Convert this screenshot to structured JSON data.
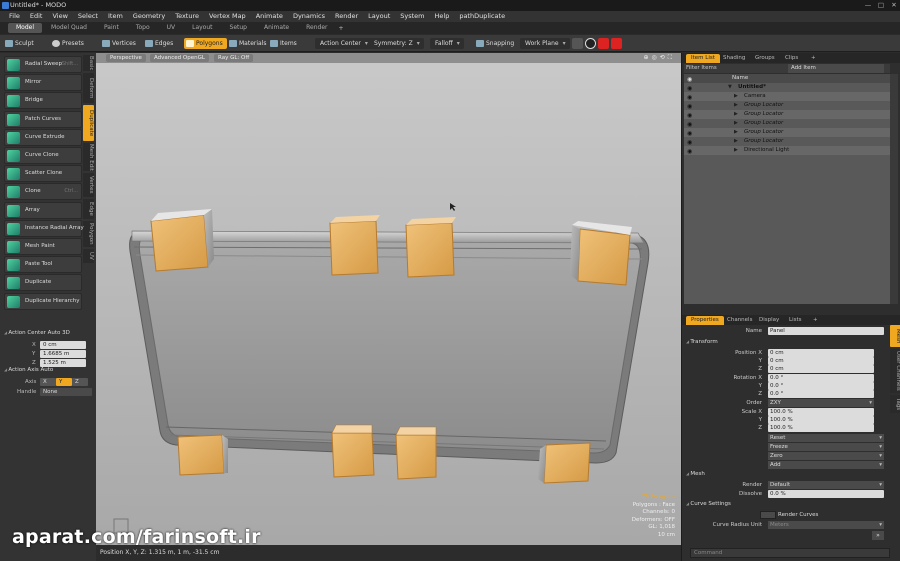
{
  "window": {
    "title": "Untitled* - MODO",
    "controls": [
      "—",
      "□",
      "✕"
    ]
  },
  "menu": [
    "File",
    "Edit",
    "View",
    "Select",
    "Item",
    "Geometry",
    "Texture",
    "Vertex Map",
    "Animate",
    "Dynamics",
    "Render",
    "Layout",
    "System",
    "Help",
    "pathDuplicate"
  ],
  "layout_tabs": [
    "Model",
    "Model Quad",
    "Paint",
    "Topo",
    "UV",
    "Layout",
    "Setup",
    "Animate",
    "Render"
  ],
  "layout_tabs_active": "Model",
  "toolbar": {
    "sculpt": "Sculpt",
    "presets": "Presets",
    "vertices": "Vertices",
    "edges": "Edges",
    "polygons": "Polygons",
    "materials": "Materials",
    "items": "Items",
    "action_center": "Action Center",
    "symmetry": "Symmetry: Z",
    "falloff": "Falloff",
    "snapping": "Snapping",
    "work_plane": "Work Plane"
  },
  "left_vtabs": [
    "Basic",
    "Deform",
    "Duplicate",
    "Mesh Edit",
    "Vertex",
    "Edge",
    "Polygon",
    "UV"
  ],
  "left_vtabs_active": "Duplicate",
  "tools": [
    {
      "label": "Radial Sweep",
      "key": "Shift..."
    },
    {
      "label": "Mirror",
      "key": ""
    },
    {
      "label": "Bridge",
      "key": ""
    },
    {
      "label": "Patch Curves",
      "key": ""
    },
    {
      "label": "Curve Extrude",
      "key": ""
    },
    {
      "label": "Curve Clone",
      "key": ""
    },
    {
      "label": "Scatter Clone",
      "key": ""
    },
    {
      "label": "Clone",
      "key": "Ctrl..."
    },
    {
      "label": "Array",
      "key": ""
    },
    {
      "label": "Instance Radial Array",
      "key": ""
    },
    {
      "label": "Mesh Paint",
      "key": ""
    },
    {
      "label": "Paste Tool",
      "key": ""
    },
    {
      "label": "Duplicate",
      "key": ""
    },
    {
      "label": "Duplicate Hierarchy",
      "key": ""
    }
  ],
  "action_center": {
    "title": "Action Center Auto 3D",
    "x": "0 cm",
    "y": "1.6685 m",
    "z": "1.525 m"
  },
  "action_axis": {
    "title": "Action Axis Auto",
    "axis_label": "Axis",
    "axis_options": [
      "X",
      "Y",
      "Z"
    ],
    "axis_selected": "Y",
    "handle_label": "Handle",
    "handle_value": "None"
  },
  "viewport": {
    "view": "Perspective",
    "shading": "Advanced OpenGL",
    "raygl": "Ray GL: Off",
    "info": {
      "polygons_count": "76 Polygons",
      "polygons_mode": "Polygons : Face",
      "channels": "Channels: 0",
      "deformers": "Deformers: OFF",
      "gl": "GL: 1,018",
      "scale": "10 cm"
    }
  },
  "status_bar": "Position X, Y, Z:  1.315 m, 1 m, -31.5 cm",
  "item_list": {
    "tabs": [
      "Item List",
      "Shading",
      "Groups",
      "Clips"
    ],
    "active_tab": "Item List",
    "filter_label": "Filter Items",
    "add_item": "Add Item",
    "column": "Name",
    "rows": [
      {
        "name": "Untitled*",
        "level": 0,
        "bold": true
      },
      {
        "name": "Camera",
        "level": 1
      },
      {
        "name": "Group Locator",
        "level": 1
      },
      {
        "name": "Group Locator",
        "level": 1
      },
      {
        "name": "Group Locator",
        "level": 1
      },
      {
        "name": "Group Locator",
        "level": 1
      },
      {
        "name": "Group Locator",
        "level": 1
      },
      {
        "name": "Directional Light",
        "level": 1
      }
    ]
  },
  "properties": {
    "tabs": [
      "Properties",
      "Channels",
      "Display",
      "Lists"
    ],
    "active_tab": "Properties",
    "side_tabs": [
      "Mesh",
      "User Channels",
      "Tags"
    ],
    "name_label": "Name",
    "name_value": "Panel",
    "transform_title": "Transform",
    "position_label": "Position X",
    "position": [
      "0 cm",
      "0 cm",
      "0 cm"
    ],
    "rotation_label": "Rotation X",
    "rotation": [
      "0.0 °",
      "0.0 °",
      "0.0 °"
    ],
    "order_label": "Order",
    "order_value": "ZXY",
    "scale_label": "Scale X",
    "scale": [
      "100.0 %",
      "100.0 %",
      "100.0 %"
    ],
    "axis_y": "Y",
    "axis_z": "Z",
    "transform_buttons": [
      "Reset",
      "Freeze",
      "Zero",
      "Add"
    ],
    "mesh_title": "Mesh",
    "render_label": "Render",
    "render_value": "Default",
    "dissolve_label": "Dissolve",
    "dissolve_value": "0.0 %",
    "curve_title": "Curve Settings",
    "render_curves": "Render Curves",
    "curve_radius_label": "Curve Radius Unit",
    "curve_radius_value": "Meters",
    "command_placeholder": "Command"
  },
  "watermark": "aparat.com/farinsoft.ir",
  "colors": {
    "accent": "#f0a820",
    "selected_geo": "#e9b15a",
    "tool_icon": "#3fc79a"
  }
}
